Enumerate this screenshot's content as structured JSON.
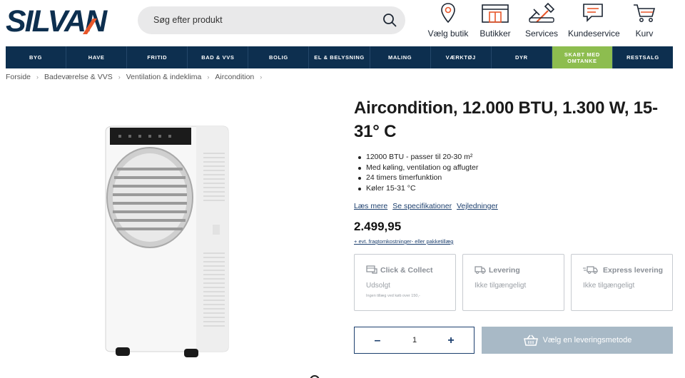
{
  "header": {
    "logo_text": "SILVAN",
    "search_placeholder": "Søg efter produkt",
    "items": [
      {
        "label": "Vælg butik",
        "icon": "map-pin-icon"
      },
      {
        "label": "Butikker",
        "icon": "store-icon"
      },
      {
        "label": "Services",
        "icon": "tools-icon"
      },
      {
        "label": "Kundeservice",
        "icon": "chat-icon"
      },
      {
        "label": "Kurv",
        "icon": "cart-icon"
      }
    ]
  },
  "nav": {
    "items": [
      {
        "label": "BYG"
      },
      {
        "label": "HAVE"
      },
      {
        "label": "FRITID"
      },
      {
        "label": "BAD & VVS"
      },
      {
        "label": "BOLIG"
      },
      {
        "label": "EL & BELYSNING"
      },
      {
        "label": "MALING"
      },
      {
        "label": "VÆRKTØJ"
      },
      {
        "label": "DYR"
      },
      {
        "label": "SKABT MED\nOMTANKE",
        "highlight": "#8dbd4f"
      },
      {
        "label": "RESTSALG"
      }
    ]
  },
  "breadcrumb": [
    "Forside",
    "Badeværelse & VVS",
    "Ventilation & indeklima",
    "Aircondition"
  ],
  "product": {
    "title": "Aircondition, 12.000 BTU, 1.300 W, 15-31° C",
    "bullets": [
      "12000 BTU - passer til 20-30 m²",
      "Med køling, ventilation og affugter",
      "24 timers timerfunktion",
      "Køler 15-31 °C"
    ],
    "links": [
      "Læs mere",
      "Se specifikationer",
      "Vejledninger"
    ],
    "price": "2.499,95",
    "shipping_note": "+ evt. fragtomkostninger- eller pakketillæg"
  },
  "delivery_options": [
    {
      "title": "Click & Collect",
      "status": "Udsolgt",
      "note": "Ingen tillæg ved køb over 150,-",
      "icon": "click-collect-icon"
    },
    {
      "title": "Levering",
      "status": "Ikke tilgængeligt",
      "note": "",
      "icon": "truck-icon"
    },
    {
      "title": "Express levering",
      "status": "Ikke tilgængeligt",
      "note": "",
      "icon": "express-truck-icon"
    }
  ],
  "quantity": {
    "minus": "–",
    "value": "1",
    "plus": "+"
  },
  "cta": {
    "label": "Vælg en leveringsmetode",
    "icon": "basket-icon"
  },
  "colors": {
    "brand_navy": "#0d2f4f",
    "accent_orange": "#e8562a",
    "green": "#8dbd4f",
    "button_disabled": "#a8b9c6"
  }
}
